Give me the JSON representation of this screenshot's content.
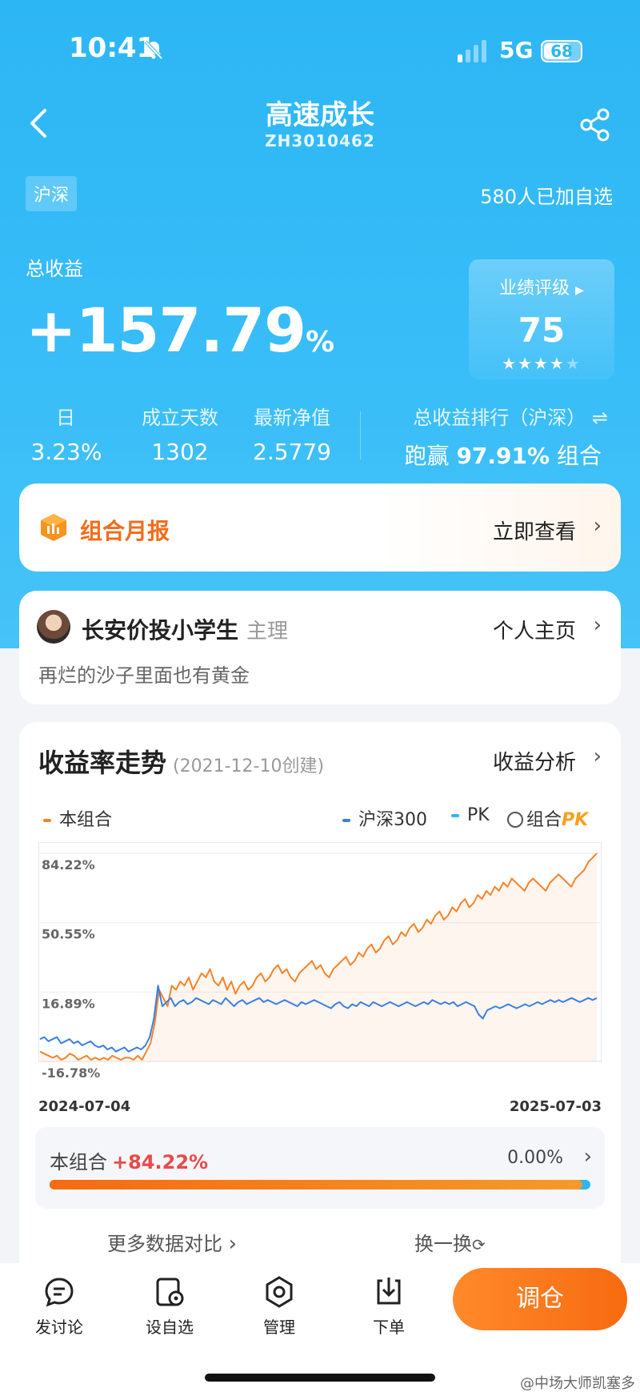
{
  "status": {
    "time": "10:41",
    "network": "5G",
    "battery": "68"
  },
  "header": {
    "title": "高速成长",
    "code": "ZH3010462"
  },
  "market_tag": "沪深",
  "watchers": "580人已加自选",
  "total": {
    "label": "总收益",
    "value": "+157.79",
    "unit": "%"
  },
  "rating": {
    "label": "业绩评级",
    "value": "75",
    "stars": 4,
    "max_stars": 5
  },
  "stats": [
    {
      "label": "日",
      "value": "3.23%"
    },
    {
      "label": "成立天数",
      "value": "1302"
    },
    {
      "label": "最新净值",
      "value": "2.5779"
    }
  ],
  "rank": {
    "label": "总收益排行（沪深）",
    "prefix": "跑赢",
    "value": "97.91%",
    "suffix": "组合"
  },
  "report": {
    "title": "组合月报",
    "action": "立即查看"
  },
  "manager": {
    "name": "长安价投小学生",
    "role": "主理",
    "profile_link": "个人主页",
    "motto": "再烂的沙子里面也有黄金"
  },
  "trend": {
    "title": "收益率走势",
    "created": "(2021-12-10创建)",
    "analysis_link": "收益分析",
    "legend": {
      "portfolio": "本组合",
      "index": "沪深300",
      "pk": "PK",
      "pk_option": "组合",
      "pk_word": "PK"
    },
    "compare": {
      "label": "本组合",
      "value": "+84.22%",
      "right_value": "0.00%",
      "bar_fraction": 0.985
    },
    "more_link": "更多数据对比",
    "swap_link": "换一换"
  },
  "colors": {
    "portfolio": "#f5832a",
    "index": "#3b7fe0",
    "pk": "#2cb6f3",
    "hero": "#2cb6f3",
    "accent": "#f76a10"
  },
  "chart_data": {
    "type": "line",
    "x_start": "2024-07-04",
    "x_end": "2025-07-03",
    "yticks": [
      "84.22%",
      "50.55%",
      "16.89%",
      "-16.78%"
    ],
    "ylim": [
      -16.78,
      84.22
    ],
    "series": [
      {
        "name": "本组合",
        "color": "#f5832a",
        "values": [
          -12,
          -13,
          -14,
          -15,
          -14,
          -16,
          -15,
          -13,
          -14,
          -16,
          -15,
          -14,
          -16,
          -15,
          -16,
          -15,
          -16,
          -14,
          -15,
          -16,
          -15,
          -15,
          -16,
          -14,
          -16,
          -12,
          -8,
          2,
          18,
          14,
          10,
          20,
          18,
          22,
          20,
          24,
          18,
          22,
          26,
          24,
          28,
          22,
          20,
          24,
          18,
          22,
          16,
          20,
          22,
          18,
          20,
          24,
          26,
          22,
          24,
          28,
          30,
          26,
          28,
          24,
          22,
          26,
          28,
          30,
          32,
          28,
          30,
          26,
          24,
          28,
          30,
          32,
          34,
          30,
          32,
          36,
          34,
          38,
          40,
          36,
          38,
          42,
          44,
          40,
          42,
          46,
          44,
          48,
          50,
          46,
          48,
          52,
          50,
          54,
          56,
          52,
          54,
          58,
          56,
          60,
          62,
          58,
          60,
          64,
          62,
          66,
          64,
          68,
          66,
          70,
          68,
          72,
          70,
          68,
          66,
          70,
          72,
          70,
          68,
          66,
          70,
          72,
          74,
          72,
          70,
          68,
          72,
          74,
          76,
          80,
          82,
          84.22
        ]
      },
      {
        "name": "沪深300",
        "color": "#3b7fe0",
        "values": [
          -6,
          -5,
          -7,
          -6,
          -5,
          -8,
          -7,
          -6,
          -8,
          -7,
          -9,
          -8,
          -7,
          -9,
          -10,
          -9,
          -11,
          -10,
          -12,
          -11,
          -10,
          -12,
          -11,
          -10,
          -11,
          -9,
          -5,
          4,
          20,
          10,
          12,
          14,
          10,
          12,
          13,
          11,
          12,
          14,
          13,
          12,
          11,
          13,
          12,
          11,
          14,
          12,
          10,
          12,
          13,
          11,
          12,
          13,
          14,
          12,
          13,
          12,
          11,
          12,
          13,
          12,
          11,
          10,
          12,
          11,
          12,
          13,
          12,
          11,
          10,
          9,
          11,
          12,
          10,
          9,
          11,
          10,
          12,
          11,
          10,
          12,
          11,
          10,
          11,
          12,
          11,
          10,
          11,
          12,
          11,
          10,
          11,
          12,
          11,
          13,
          12,
          11,
          12,
          11,
          12,
          10,
          11,
          12,
          11,
          10,
          6,
          4,
          8,
          9,
          10,
          9,
          10,
          11,
          10,
          9,
          10,
          11,
          10,
          11,
          12,
          11,
          12,
          13,
          12,
          13,
          12,
          13,
          14,
          13,
          12,
          13,
          14,
          13,
          14
        ]
      }
    ]
  }
}
